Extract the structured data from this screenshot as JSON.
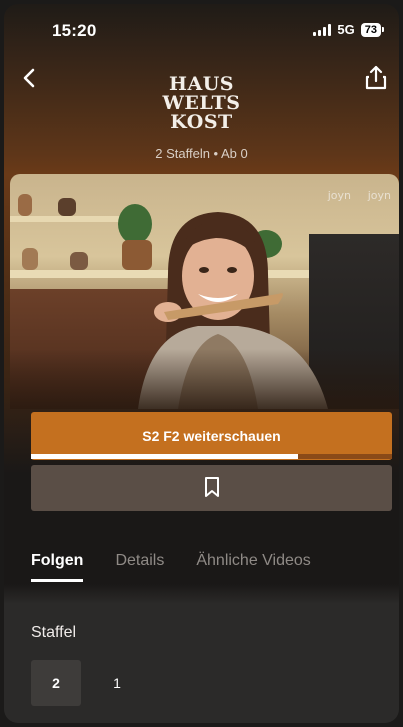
{
  "status_bar": {
    "time": "15:20",
    "network": "5G",
    "battery": "73"
  },
  "header": {
    "logo_line1": "HAUS",
    "logo_line2": "WELTS",
    "logo_line3": "KOST",
    "meta": "2 Staffeln • Ab 0"
  },
  "hero": {
    "watermark_1": "joyn",
    "watermark_2": "joyn"
  },
  "actions": {
    "continue_label": "S2 F2 weiterschauen",
    "continue_progress": 0.74
  },
  "tabs": [
    {
      "label": "Folgen"
    },
    {
      "label": "Details"
    },
    {
      "label": "Ähnliche Videos"
    }
  ],
  "seasons": {
    "label": "Staffel",
    "items": [
      "2",
      "1"
    ],
    "selected": "2"
  },
  "colors": {
    "accent": "#c4701f",
    "bookmark_bg": "#5a4e46"
  }
}
